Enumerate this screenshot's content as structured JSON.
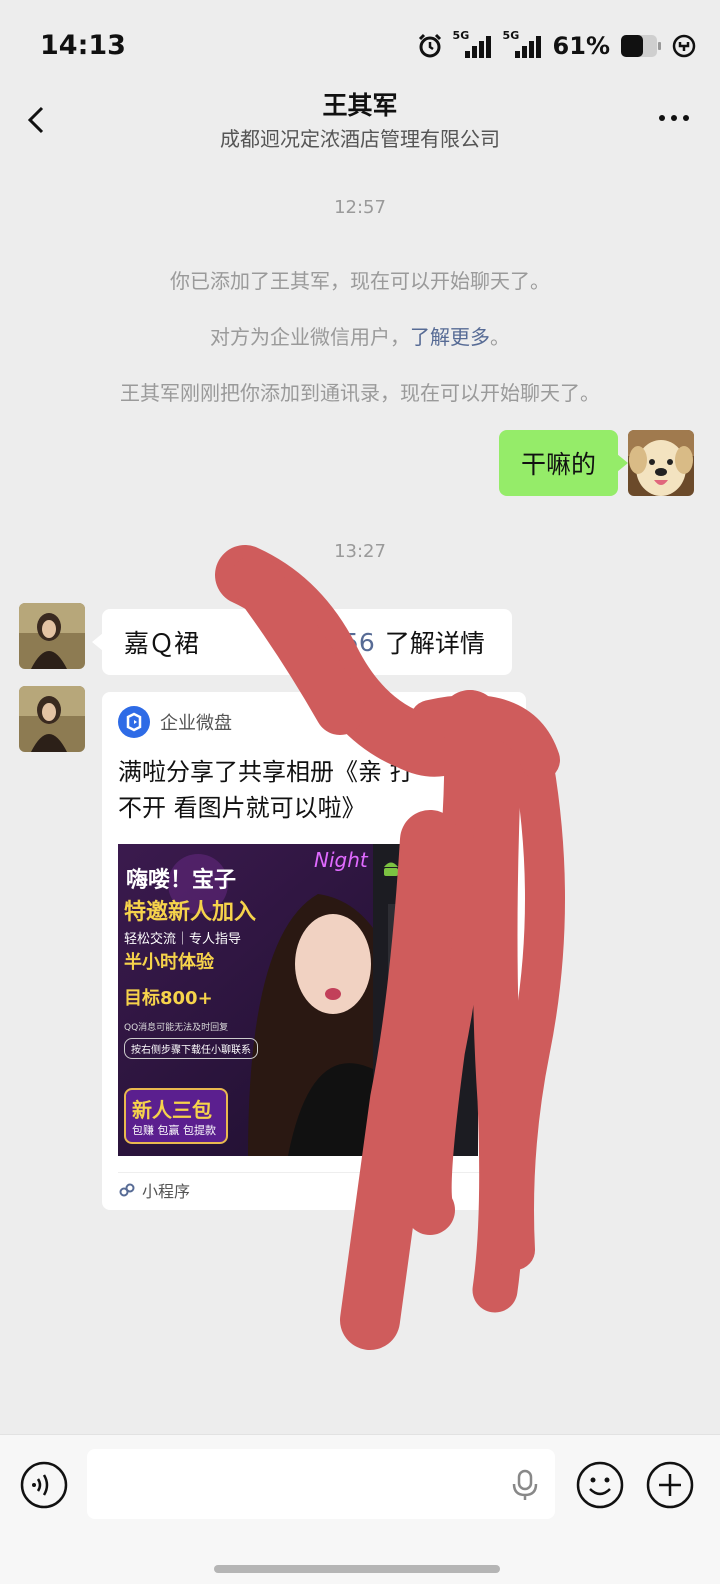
{
  "status_bar": {
    "time": "14:13",
    "network_1": "5G",
    "network_2": "5G",
    "battery": "61%"
  },
  "header": {
    "title": "王其军",
    "subtitle": "成都迥况定浓酒店管理有限公司",
    "back_icon": "chevron-left-icon",
    "more_icon": "more-dots-icon"
  },
  "messages": {
    "time_1": "12:57",
    "system_1": "你已添加了王其军，现在可以开始聊天了。",
    "system_2_prefix": "对方为企业微信用户，",
    "system_2_link": "了解更多",
    "system_2_suffix": "。",
    "system_3": "王其军刚刚把你添加到通讯录，现在可以开始聊天了。",
    "outgoing_1": "干嘛的",
    "time_2": "13:27",
    "incoming_1_part1": "嘉Ｑ裙",
    "incoming_1_part2": "56",
    "incoming_1_part3": "了解详情",
    "card": {
      "source": "企业微盘",
      "title": "满啦分享了共享相册《亲 打不开 看图片就可以啦》",
      "footer": "小程序",
      "poster": {
        "line1": "嗨喽！宝子",
        "line2": "特邀新人加入",
        "line3": "轻松交流｜专人指导",
        "line4": "半小时体验",
        "line5": "目标800+",
        "line6": "QQ消息可能无法及时回复",
        "line7": "按右侧步骤下载任小聊联系",
        "badge_title": "新人三包",
        "badge_sub": "包赚 包赢 包提款",
        "tag": "Night"
      }
    }
  },
  "input_bar": {
    "voice_icon": "voice-icon",
    "mic_icon": "microphone-icon",
    "emoji_icon": "emoji-icon",
    "plus_icon": "plus-icon"
  },
  "colors": {
    "background": "#ededed",
    "outgoing_bubble": "#95ec69",
    "link": "#576b95",
    "scribble": "#cf5c5c"
  }
}
